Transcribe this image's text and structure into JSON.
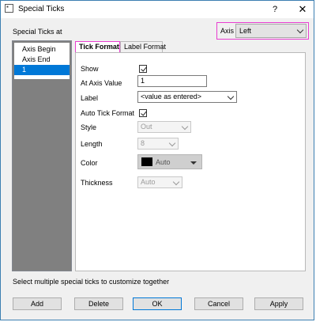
{
  "window": {
    "title": "Special Ticks",
    "help_glyph": "?",
    "close_glyph": "✕",
    "icon": "app-icon"
  },
  "special_ticks_label": "Special Ticks at",
  "axis": {
    "label": "Axis",
    "selected": "Left"
  },
  "tick_list": {
    "items": [
      "Axis Begin",
      "Axis End",
      "1"
    ],
    "selected_index": 2
  },
  "tabs": [
    {
      "label": "Tick Format",
      "active": true
    },
    {
      "label": "Label Format",
      "active": false
    }
  ],
  "tick_format": {
    "show": {
      "label": "Show",
      "checked": true
    },
    "at_axis_value": {
      "label": "At Axis Value",
      "value": "1"
    },
    "label": {
      "label": "Label",
      "value": "<value as entered>"
    },
    "auto_tick_format": {
      "label": "Auto Tick Format",
      "checked": true
    },
    "style": {
      "label": "Style",
      "value": "Out"
    },
    "length": {
      "label": "Length",
      "value": "8"
    },
    "color": {
      "label": "Color",
      "value": "Auto",
      "swatch": "#000000"
    },
    "thickness": {
      "label": "Thickness",
      "value": "Auto"
    }
  },
  "hint": "Select multiple special ticks to customize together",
  "buttons": {
    "add": "Add",
    "delete": "Delete",
    "ok": "OK",
    "cancel": "Cancel",
    "apply": "Apply"
  },
  "colors": {
    "highlight": "#e83ed0",
    "selection": "#0078d7"
  }
}
